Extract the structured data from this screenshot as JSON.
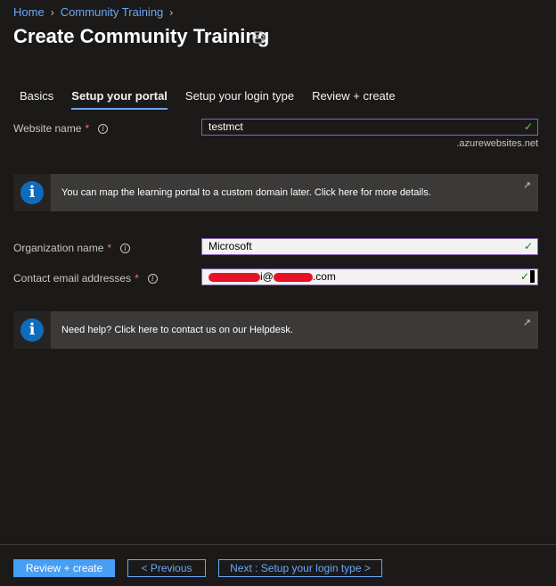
{
  "breadcrumb": {
    "home": "Home",
    "current": "Community Training"
  },
  "page": {
    "title": "Create Community Training"
  },
  "tabs": [
    "Basics",
    "Setup your portal",
    "Setup your login type",
    "Review + create"
  ],
  "form": {
    "website_name": {
      "label": "Website name",
      "value": "testmct",
      "suffix": ".azurewebsites.net"
    },
    "org_name": {
      "label": "Organization name",
      "value": "Microsoft"
    },
    "contact_email": {
      "label": "Contact email addresses",
      "value_mid": "i@",
      "value_end": ".com"
    },
    "required_mark": "*"
  },
  "banners": {
    "domain": "You can map the learning portal to a custom domain later. Click here for more details.",
    "help": "Need help? Click here to contact us on our Helpdesk."
  },
  "footer": {
    "review": "Review + create",
    "previous": "< Previous",
    "next": "Next : Setup your login type >"
  },
  "colors": {
    "accent": "#6aa6f8",
    "primary_button": "#479ef5",
    "banner_icon": "#0f6cbd",
    "redaction": "#e81123"
  }
}
